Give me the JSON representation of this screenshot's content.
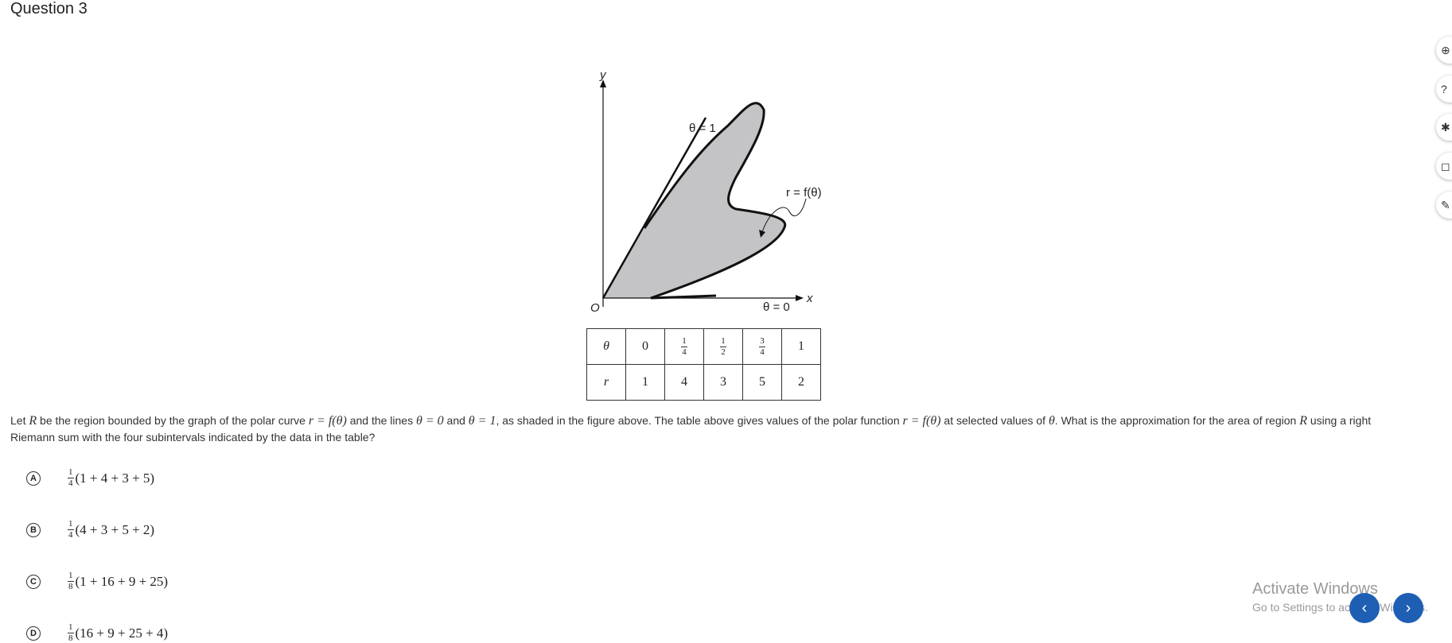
{
  "question": {
    "title": "Question 3"
  },
  "figure": {
    "y_label": "y",
    "x_label": "x",
    "origin_label": "O",
    "theta1_label": "θ = 1",
    "theta0_label": "θ = 0",
    "curve_label": "r = f(θ)",
    "fill_color": "#c4c4c6",
    "stroke_color": "#111111"
  },
  "table": {
    "theta_header": "θ",
    "r_header": "r",
    "theta_values": [
      {
        "whole": "0"
      },
      {
        "num": "1",
        "den": "4"
      },
      {
        "num": "1",
        "den": "2"
      },
      {
        "num": "3",
        "den": "4"
      },
      {
        "whole": "1"
      }
    ],
    "r_values": [
      "1",
      "4",
      "3",
      "5",
      "2"
    ]
  },
  "stem": {
    "p1": "Let ",
    "R1": "R",
    "p2": " be the region bounded by the graph of the polar curve ",
    "m1": "r = f(θ)",
    "p3": " and the lines ",
    "m2": "θ = 0",
    "p4": " and ",
    "m3": "θ = 1",
    "p5": ", as shaded in the figure above. The table above gives values of the polar function ",
    "m4": "r = f(θ)",
    "p6": " at selected values of ",
    "m5": "θ",
    "p7": ". What is the approximation for the area of region ",
    "R2": "R",
    "p8": " using a right Riemann sum with the four subintervals indicated by the data in the table?"
  },
  "choices": [
    {
      "letter": "A",
      "num": "1",
      "den": "4",
      "expr": "(1 + 4 + 3 + 5)"
    },
    {
      "letter": "B",
      "num": "1",
      "den": "4",
      "expr": "(4 + 3 + 5 + 2)"
    },
    {
      "letter": "C",
      "num": "1",
      "den": "8",
      "expr": "(1 + 16 + 9 + 25)"
    },
    {
      "letter": "D",
      "num": "1",
      "den": "8",
      "expr": "(16 + 9 + 25 + 4)"
    }
  ],
  "tools": [
    {
      "icon": "zoom-icon",
      "glyph": "⊕"
    },
    {
      "icon": "help-icon",
      "glyph": "?"
    },
    {
      "icon": "settings-icon",
      "glyph": "✱"
    },
    {
      "icon": "bookmark-icon",
      "glyph": "◻"
    },
    {
      "icon": "pencil-icon",
      "glyph": "✎"
    }
  ],
  "watermark": {
    "line1": "Activate Windows",
    "line2": "Go to Settings to activate Windows."
  },
  "nav": {
    "prev": "‹",
    "next": "›",
    "color": "#1e5fb4"
  }
}
